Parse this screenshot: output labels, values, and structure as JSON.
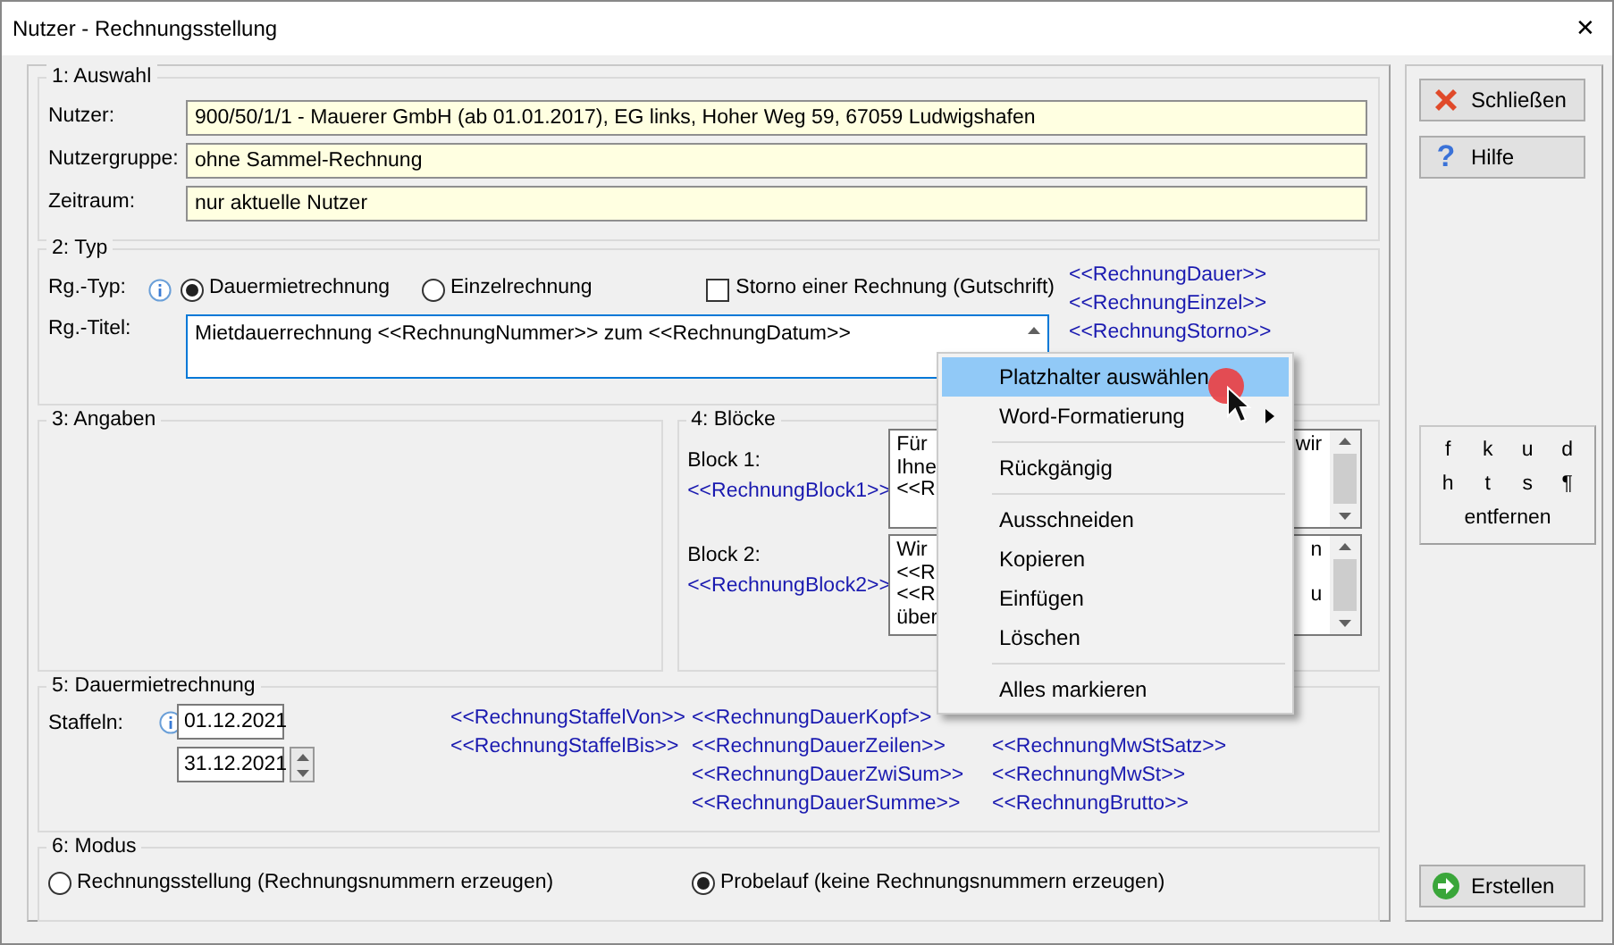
{
  "window": {
    "title": "Nutzer - Rechnungsstellung",
    "close": "✕"
  },
  "auswahl": {
    "title": "1: Auswahl",
    "fields": [
      {
        "label": "Nutzer:",
        "value": "900/50/1/1 - Mauerer GmbH  (ab 01.01.2017), EG links, Hoher Weg 59, 67059 Ludwigshafen"
      },
      {
        "label": "Nutzergruppe:",
        "value": "ohne Sammel-Rechnung"
      },
      {
        "label": "Zeitraum:",
        "value": "nur aktuelle Nutzer"
      }
    ]
  },
  "typ": {
    "title": "2: Typ",
    "type_label": "Rg.-Typ:",
    "radios": [
      {
        "label": "Dauermietrechnung",
        "selected": true
      },
      {
        "label": "Einzelrechnung",
        "selected": false
      }
    ],
    "storno": {
      "label": "Storno einer Rechnung (Gutschrift)",
      "checked": false
    },
    "title_label": "Rg.-Titel:",
    "title_value": "Mietdauerrechnung <<RechnungNummer>> zum <<RechnungDatum>>",
    "placeholders": [
      "<<RechnungDauer>>",
      "<<RechnungEinzel>>",
      "<<RechnungStorno>>"
    ]
  },
  "angaben": {
    "title": "3: Angaben"
  },
  "bloecke": {
    "title": "4: Blöcke",
    "blocks": [
      {
        "label": "Block 1:",
        "placeholder": "<<RechnungBlock1>>",
        "lines": [
          {
            "left": "Für",
            "right": "wir"
          },
          {
            "left": "Ihne"
          },
          {
            "left": "<<R"
          }
        ]
      },
      {
        "label": "Block 2:",
        "placeholder": "<<RechnungBlock2>>",
        "lines": [
          {
            "left": "Wir",
            "right": "n"
          },
          {
            "left": "<<R"
          },
          {
            "left": "<<R",
            "right": "u"
          },
          {
            "left": "über"
          }
        ]
      }
    ]
  },
  "dauer": {
    "title": "5: Dauermietrechnung",
    "staffeln_label": "Staffeln:",
    "dates": [
      "01.12.2021",
      "31.12.2021"
    ],
    "placeholder_columns": [
      [
        "<<RechnungStaffelVon>>",
        "<<RechnungStaffelBis>>"
      ],
      [
        "<<RechnungDauerKopf>>",
        "<<RechnungDauerZeilen>>",
        "<<RechnungDauerZwiSum>>",
        "<<RechnungDauerSumme>>"
      ],
      [
        "<<RechnungMwStSatz>>",
        "<<RechnungMwSt>>",
        "<<RechnungBrutto>>"
      ]
    ]
  },
  "modus": {
    "title": "6: Modus",
    "options": [
      {
        "label": "Rechnungsstellung (Rechnungsnummern erzeugen)",
        "selected": false
      },
      {
        "label": "Probelauf (keine Rechnungsnummern erzeugen)",
        "selected": true
      }
    ]
  },
  "side_buttons": [
    {
      "label": "Schließen",
      "kind": "close"
    },
    {
      "label": "Hilfe",
      "kind": "help",
      "glyph": "?"
    }
  ],
  "format_box": {
    "keys": [
      "f",
      "k",
      "u",
      "d",
      "h",
      "t",
      "s",
      "¶"
    ],
    "remove": "entfernen"
  },
  "create_button": {
    "label": "Erstellen"
  },
  "context_menu": [
    {
      "kind": "item",
      "label": "Platzhalter auswählen",
      "selected": true,
      "submenu": false
    },
    {
      "kind": "item",
      "label": "Word-Formatierung",
      "selected": false,
      "submenu": true
    },
    {
      "kind": "separator"
    },
    {
      "kind": "item",
      "label": "Rückgängig",
      "selected": false,
      "submenu": false
    },
    {
      "kind": "separator"
    },
    {
      "kind": "item",
      "label": "Ausschneiden",
      "selected": false,
      "submenu": false
    },
    {
      "kind": "item",
      "label": "Kopieren",
      "selected": false,
      "submenu": false
    },
    {
      "kind": "item",
      "label": "Einfügen",
      "selected": false,
      "submenu": false
    },
    {
      "kind": "item",
      "label": "Löschen",
      "selected": false,
      "submenu": false
    },
    {
      "kind": "separator"
    },
    {
      "kind": "item",
      "label": "Alles markieren",
      "selected": false,
      "submenu": false
    }
  ]
}
